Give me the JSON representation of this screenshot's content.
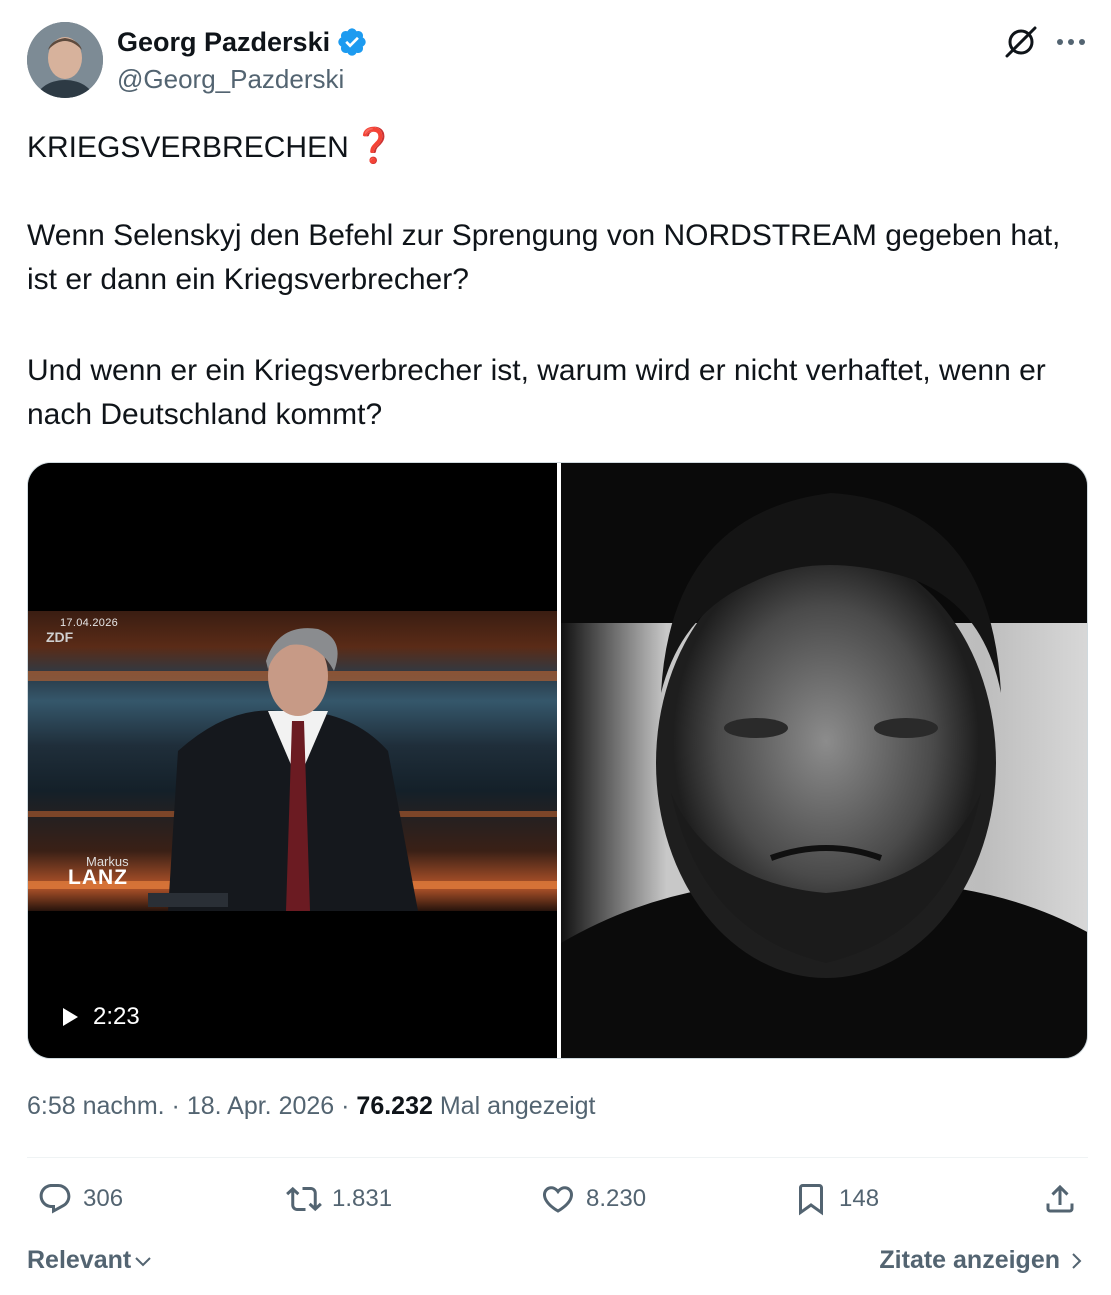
{
  "author": {
    "display_name": "Georg Pazderski",
    "handle": "@Georg_Pazderski",
    "verified": true
  },
  "tweet": {
    "headline": "KRIEGSVERBRECHEN",
    "headline_emoji": "❓",
    "paragraph_1": "Wenn Selenskyj den Befehl zur Sprengung von NORDSTREAM gegeben hat, ist er dann ein Kriegsverbrecher?",
    "paragraph_2": "Und wenn er ein Kriegsverbrecher ist, warum wird er nicht verhaftet, wenn er nach Deutschland kommt?"
  },
  "media": {
    "video": {
      "date_overlay": "17.04.2026",
      "channel_logo": "ZDF",
      "show_name_small": "Markus",
      "show_name_big": "LANZ",
      "duration": "2:23"
    }
  },
  "meta": {
    "time": "6:58 nachm.",
    "date": "18. Apr. 2026",
    "separator": "·",
    "views": "76.232",
    "views_label": "Mal angezeigt"
  },
  "actions": {
    "replies": "306",
    "reposts": "1.831",
    "likes": "8.230",
    "bookmarks": "148"
  },
  "footer": {
    "sort_label": "Relevant",
    "quotes_label": "Zitate anzeigen"
  },
  "colors": {
    "text": "#0f1419",
    "secondary": "#536471",
    "verified": "#1d9bf0",
    "emoji": "#dd2e44"
  }
}
